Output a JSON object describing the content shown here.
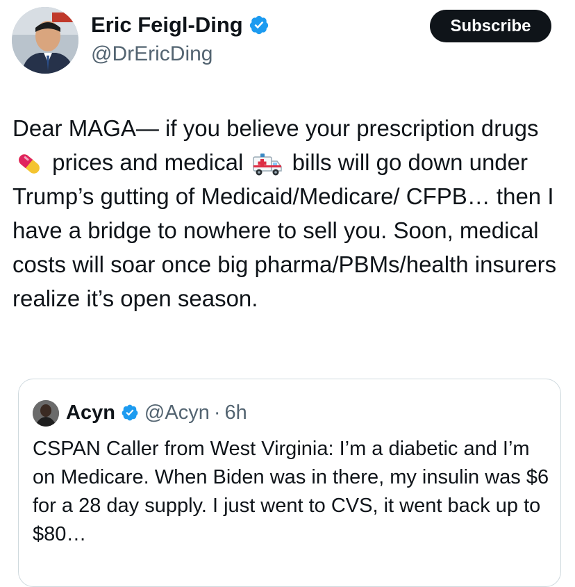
{
  "author": {
    "name": "Eric Feigl-Ding",
    "handle": "@DrEricDing",
    "verified": true
  },
  "subscribe_label": "Subscribe",
  "tweet": {
    "seg1": "Dear MAGA— if you believe your prescription drugs",
    "emoji1": "pill-emoji",
    "seg2": "prices and medical",
    "emoji2": "ambulance-emoji",
    "seg3": "bills will go down under Trump’s gutting of Medicaid/Medicare/ CFPB… then I have a bridge to nowhere to sell you. Soon, medical costs will soar once big pharma/PBMs/health insurers realize it’s open season."
  },
  "quote": {
    "name": "Acyn",
    "handle": "@Acyn",
    "separator": "·",
    "time": "6h",
    "text": "CSPAN Caller from West Virginia: I’m a diabetic and I’m on Medicare. When Biden was in there, my insulin was $6 for a 28 day supply. I just went to CVS, it went back up to $80…"
  },
  "colors": {
    "verified": "#1d9bf0",
    "text": "#0f1419",
    "secondary": "#536471",
    "button_bg": "#0f1419",
    "border": "#cfd9de"
  }
}
